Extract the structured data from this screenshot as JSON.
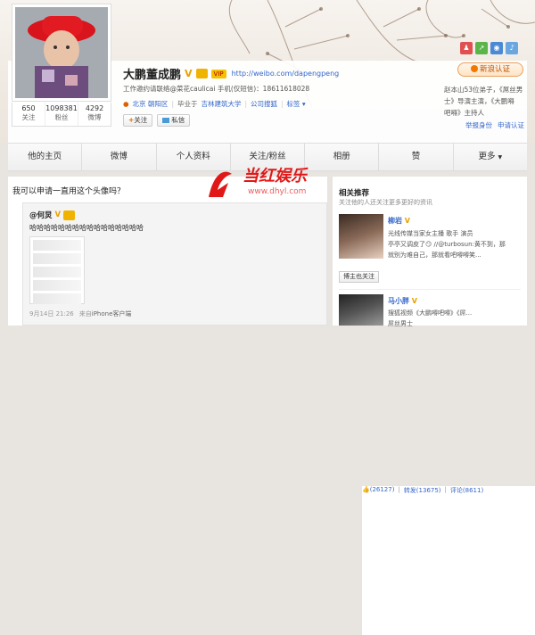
{
  "profile": {
    "name": "大鹏董成鹏",
    "v_badge": "V",
    "vip_label": "VIP",
    "url": "http://weibo.com/dapengpeng",
    "bio": "工作邀约请联络@菜花caulicai 手机(仅短信)：18611618028",
    "location": "北京 朝阳区",
    "school_prefix": "毕业于",
    "school": "吉林建筑大学",
    "company": "公司搜狐",
    "tags_label": "标签",
    "follow_button": "关注",
    "message_button": "私信",
    "stats": [
      {
        "num": "650",
        "label": "关注"
      },
      {
        "num": "1098381",
        "label": "粉丝"
      },
      {
        "num": "4292",
        "label": "微博"
      }
    ]
  },
  "side": {
    "verify_button": "新浪认证",
    "text_line1": "赵本山53位弟子，《屌丝男",
    "text_line2": "士》导演主演，《大鹏嘚",
    "text_line3": "吧嘚》主持人",
    "report_link": "举报身份",
    "apply_link": "申请认证"
  },
  "nav": {
    "items": [
      "他的主页",
      "微博",
      "个人资料",
      "关注/粉丝",
      "相册",
      "赞",
      "更多"
    ]
  },
  "watermark": {
    "text": "当红娱乐",
    "sub": "www.dhyl.com"
  },
  "main": {
    "question": "我可以申请一直用这个头像吗？",
    "post_author": "@何炅",
    "post_text": "哈哈哈哈哈哈哈哈哈哈哈哈哈哈哈哈",
    "post_date": "9月14日 21:26",
    "post_source_prefix": "来自",
    "post_source": "iPhone客户端",
    "likes": "(26127)",
    "reposts": "转发(13675)",
    "comments": "评论(8611)"
  },
  "recommend": {
    "title": "相关推荐",
    "subtitle": "关注他的人还关注更多更好的资讯",
    "person1_name": "柳岩",
    "person1_desc1": "光线传媒当家女主播 歌手 演员",
    "person1_desc2": "亭亭又调皮了😏 //@turbosun:黄不到，那",
    "person1_desc3": "就别为难自己，那就看吧嘚嘚笑...",
    "person1_button": "博主也关注",
    "person2_name": "马小胖",
    "person2_desc1": "搜狐视频《大鹏嘚吧嘚》《屌...",
    "person2_desc2": "屌丝男士"
  }
}
